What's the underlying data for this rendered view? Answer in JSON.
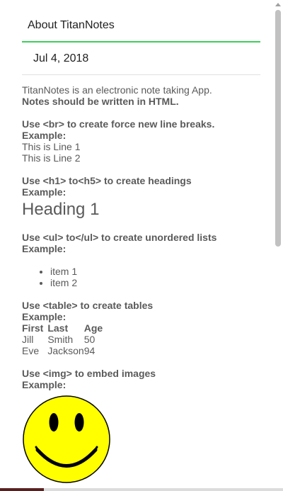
{
  "header": {
    "title": "About TitanNotes"
  },
  "note": {
    "date": "Jul 4, 2018"
  },
  "body": {
    "intro": "TitanNotes is an electronic note taking App.",
    "intro_bold": "Notes should be written in HTML.",
    "br_title": "Use <br> to create force new line breaks.",
    "br_example_label": "Example:",
    "br_line1": "This is Line 1",
    "br_line2": "This is Line 2",
    "h_title": "Use <h1> to<h5> to create headings",
    "h_example_label": "Example:",
    "h_example": "Heading 1",
    "ul_title": "Use <ul> to</ul> to create unordered lists",
    "ul_example_label": "Example:",
    "ul_items": [
      "item 1",
      "item 2"
    ],
    "table_title": "Use <table> to create tables",
    "table_example_label": "Example:",
    "table_headers": [
      "First",
      "Last",
      "Age"
    ],
    "table_rows": [
      [
        "Jill",
        "Smith",
        "50"
      ],
      [
        "Eve",
        "Jackson",
        "94"
      ]
    ],
    "img_title": "Use <img> to embed images",
    "img_example_label": "Example:"
  },
  "colors": {
    "accent": "#3ccf5a",
    "smiley_fill": "#ffff00",
    "text": "#5a5a5a"
  }
}
